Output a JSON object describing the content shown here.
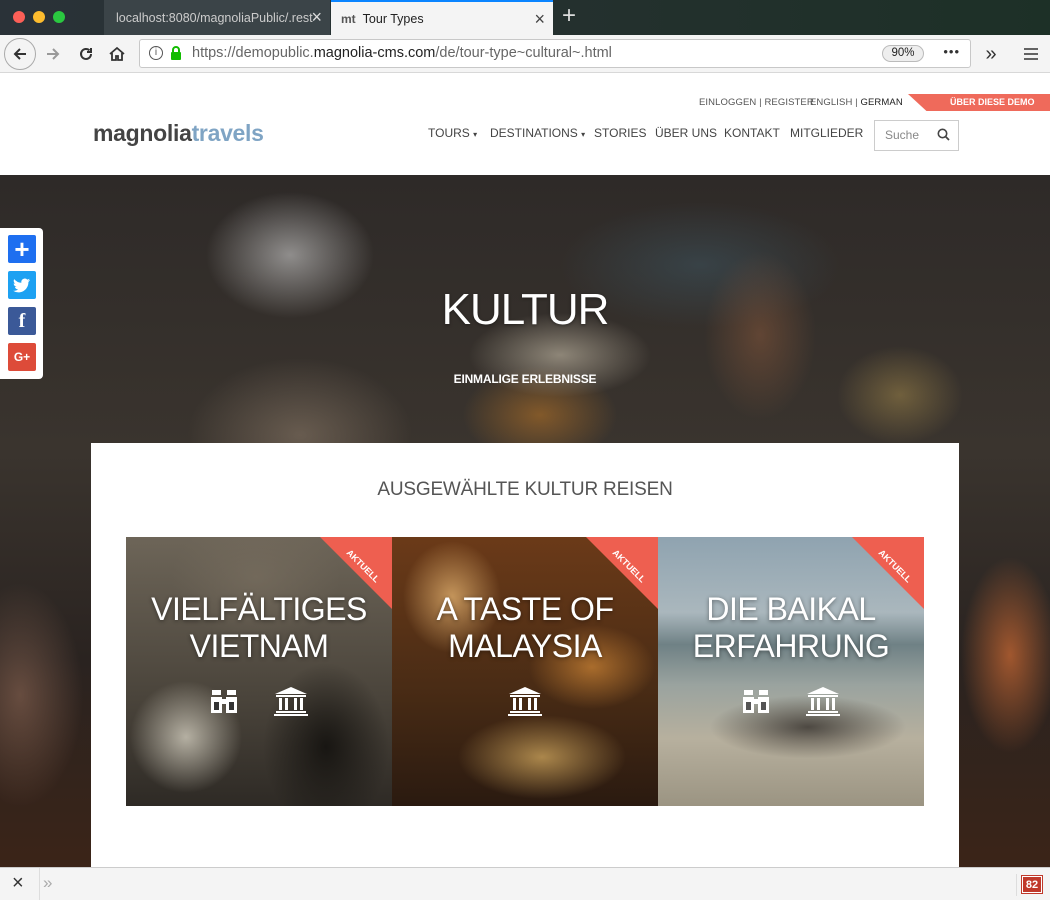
{
  "browser": {
    "tabs": [
      {
        "title": "localhost:8080/magnoliaPublic/.rest",
        "active": false
      },
      {
        "title": "Tour Types",
        "active": true,
        "favicon": "mt"
      }
    ],
    "url_prefix": "https://demopublic.",
    "url_domain": "magnolia-cms.com",
    "url_path": "/de/tour-type~cultural~.html",
    "zoom": "90%",
    "page_actions": "•••",
    "findbar_badge": "82"
  },
  "site": {
    "logo_main": "magnolia",
    "logo_accent": "travels",
    "toplinks": {
      "login": "EINLOGGEN",
      "separator": "|",
      "register": "REGISTER",
      "english": "ENGLISH",
      "german": "GERMAN"
    },
    "demo_label": "ÜBER DIESE DEMO",
    "menu": [
      "TOURS",
      "DESTINATIONS",
      "STORIES",
      "ÜBER UNS",
      "KONTAKT",
      "MITGLIEDER"
    ],
    "search_placeholder": "Suche"
  },
  "hero": {
    "title": "KULTUR",
    "subtitle": "EINMALIGE ERLEBNISSE"
  },
  "section": {
    "title": "AUSGEWÄHLTE KULTUR REISEN",
    "ribbon_label": "AKTUELL",
    "cards": [
      {
        "title_line1": "VIELFÄLTIGES",
        "title_line2": "VIETNAM",
        "icons": [
          "binoculars-icon",
          "museum-icon"
        ]
      },
      {
        "title_line1": "A TASTE OF",
        "title_line2": "MALAYSIA",
        "icons": [
          "museum-icon"
        ]
      },
      {
        "title_line1": "DIE BAIKAL",
        "title_line2": "ERFAHRUNG",
        "icons": [
          "binoculars-icon",
          "museum-icon"
        ]
      }
    ]
  },
  "share": [
    "add-share-icon",
    "twitter-icon",
    "facebook-icon",
    "google-plus-icon"
  ],
  "colors": {
    "accent": "#ef6a5b",
    "logo_dark": "#444444",
    "logo_light": "#7fa4c4",
    "share_add": "#1e6ff0",
    "twitter": "#1da1f2",
    "facebook": "#3b5998",
    "gplus": "#dd4b39"
  }
}
